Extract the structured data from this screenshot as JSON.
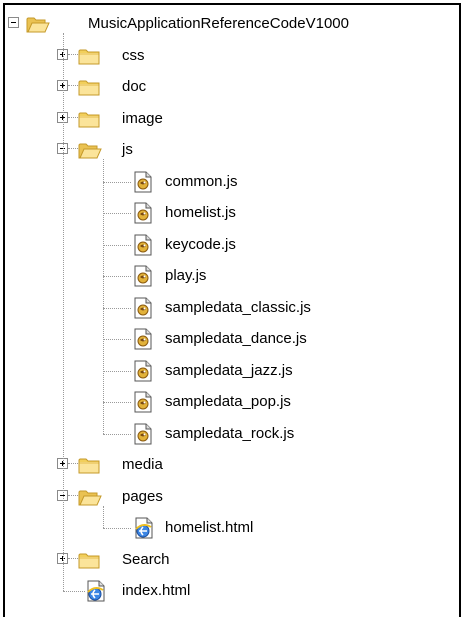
{
  "tree": {
    "root": {
      "label": "MusicApplicationReferenceCodeV1000",
      "expanded": true,
      "icon": "folder-open-icon"
    },
    "items": [
      {
        "label": "css",
        "type": "folder",
        "expanded": false
      },
      {
        "label": "doc",
        "type": "folder",
        "expanded": false
      },
      {
        "label": "image",
        "type": "folder",
        "expanded": false
      },
      {
        "label": "js",
        "type": "folder",
        "expanded": true,
        "children": [
          {
            "label": "common.js",
            "type": "js-file"
          },
          {
            "label": "homelist.js",
            "type": "js-file"
          },
          {
            "label": "keycode.js",
            "type": "js-file"
          },
          {
            "label": "play.js",
            "type": "js-file"
          },
          {
            "label": "sampledata_classic.js",
            "type": "js-file"
          },
          {
            "label": "sampledata_dance.js",
            "type": "js-file"
          },
          {
            "label": "sampledata_jazz.js",
            "type": "js-file"
          },
          {
            "label": "sampledata_pop.js",
            "type": "js-file"
          },
          {
            "label": "sampledata_rock.js",
            "type": "js-file"
          }
        ]
      },
      {
        "label": "media",
        "type": "folder",
        "expanded": false
      },
      {
        "label": "pages",
        "type": "folder",
        "expanded": true,
        "children": [
          {
            "label": "homelist.html",
            "type": "html-file"
          }
        ]
      },
      {
        "label": "Search",
        "type": "folder",
        "expanded": false
      },
      {
        "label": "index.html",
        "type": "html-file"
      }
    ]
  },
  "colors": {
    "folder_fill": "#f5d36b",
    "folder_edge": "#c59a2a",
    "connector": "#9a9a9a",
    "ie_blue": "#2a6fd6"
  }
}
